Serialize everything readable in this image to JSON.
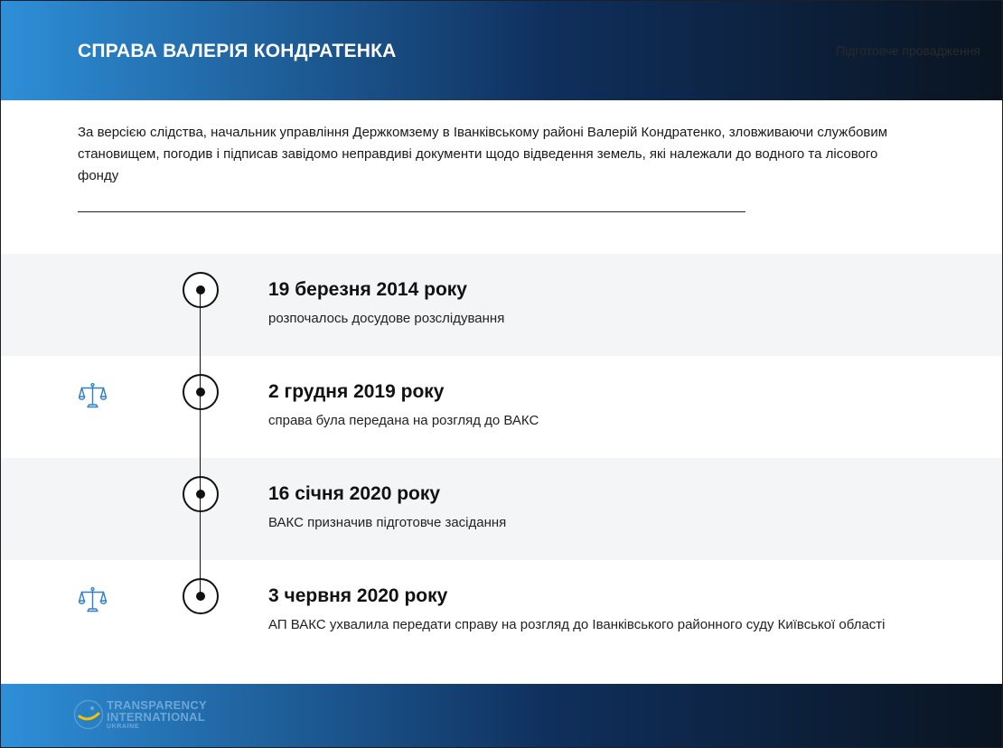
{
  "header": {
    "title": "СПРАВА ВАЛЕРІЯ КОНДРАТЕНКА",
    "stage": "Підготовче провадження"
  },
  "intro": {
    "text": "За версією слідства, начальник управління Держкомзему в Іванківському районі Валерій Кондратенко, зловживаючи службовим становищем, погодив і підписав завідомо неправдиві документи щодо відведення земель, які належали до водного та лісового фонду"
  },
  "timeline": {
    "events": [
      {
        "date": "19 березня 2014 року",
        "description": "розпочалось досудове розслідування",
        "icon": "",
        "shaded": true
      },
      {
        "date": "2 грудня 2019 року",
        "description": "справа була передана на розгляд до ВАКС",
        "icon": "scales-icon",
        "shaded": false
      },
      {
        "date": "16 січня 2020 року",
        "description": "ВАКС призначив підготовче засідання",
        "icon": "",
        "shaded": true
      },
      {
        "date": "3 червня 2020 року",
        "description": "АП ВАКС ухвалила передати справу на розгляд до Іванківського районного суду Київської області",
        "icon": "scales-icon",
        "shaded": false
      }
    ]
  },
  "footer": {
    "logo": {
      "line1": "TRANSPARENCY",
      "line2": "INTERNATIONAL",
      "line3": "UKRAINE"
    }
  },
  "colors": {
    "accent_blue": "#2e8fd8",
    "dark_navy": "#0a1420",
    "icon_blue": "#2f7fd0",
    "row_shade": "#f4f5f7"
  }
}
